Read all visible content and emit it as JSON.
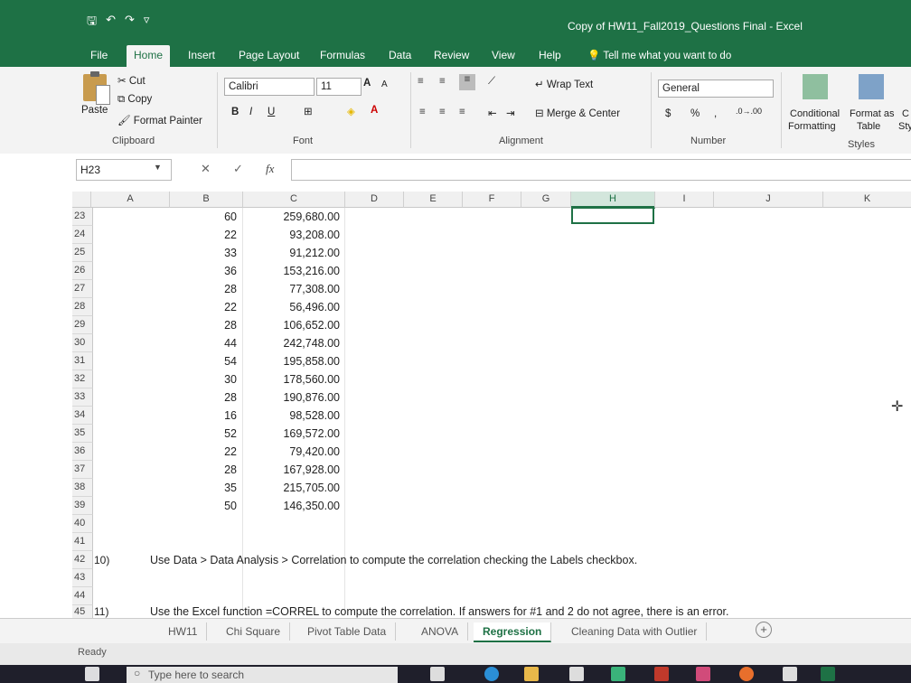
{
  "window": {
    "title": "Copy of HW11_Fall2019_Questions Final  -  Excel"
  },
  "qat": {
    "save": "🖫",
    "undo": "↶",
    "redo": "↷",
    "customize": "▿"
  },
  "tabs": [
    "File",
    "Home",
    "Insert",
    "Page Layout",
    "Formulas",
    "Data",
    "Review",
    "View",
    "Help"
  ],
  "tell_me": "Tell me what you want to do",
  "clipboard": {
    "paste": "Paste",
    "cut": "Cut",
    "copy": "Copy",
    "format_painter": "Format Painter",
    "label": "Clipboard"
  },
  "font": {
    "name": "Calibri",
    "size": "11",
    "bold": "B",
    "italic": "I",
    "underline": "U",
    "grow": "A",
    "shrink": "A",
    "label": "Font"
  },
  "alignment": {
    "wrap": "Wrap Text",
    "merge": "Merge & Center",
    "label": "Alignment"
  },
  "number": {
    "format": "General",
    "currency": "$",
    "percent": "%",
    "comma": ",",
    "label": "Number"
  },
  "styles": {
    "conditional": "Conditional",
    "conditional2": "Formatting",
    "table": "Format as",
    "table2": "Table",
    "cell": "C",
    "cell2": "Sty",
    "label": "Styles"
  },
  "formula_bar": {
    "name_box": "H23",
    "fx": "fx",
    "content": ""
  },
  "columns": [
    "A",
    "B",
    "C",
    "D",
    "E",
    "F",
    "G",
    "H",
    "I",
    "J",
    "K"
  ],
  "rows": [
    {
      "num": "23",
      "b": "60",
      "c": "259,680.00"
    },
    {
      "num": "24",
      "b": "22",
      "c": "93,208.00"
    },
    {
      "num": "25",
      "b": "33",
      "c": "91,212.00"
    },
    {
      "num": "26",
      "b": "36",
      "c": "153,216.00"
    },
    {
      "num": "27",
      "b": "28",
      "c": "77,308.00"
    },
    {
      "num": "28",
      "b": "22",
      "c": "56,496.00"
    },
    {
      "num": "29",
      "b": "28",
      "c": "106,652.00"
    },
    {
      "num": "30",
      "b": "44",
      "c": "242,748.00"
    },
    {
      "num": "31",
      "b": "54",
      "c": "195,858.00"
    },
    {
      "num": "32",
      "b": "30",
      "c": "178,560.00"
    },
    {
      "num": "33",
      "b": "28",
      "c": "190,876.00"
    },
    {
      "num": "34",
      "b": "16",
      "c": "98,528.00"
    },
    {
      "num": "35",
      "b": "52",
      "c": "169,572.00"
    },
    {
      "num": "36",
      "b": "22",
      "c": "79,420.00"
    },
    {
      "num": "37",
      "b": "28",
      "c": "167,928.00"
    },
    {
      "num": "38",
      "b": "35",
      "c": "215,705.00"
    },
    {
      "num": "39",
      "b": "50",
      "c": "146,350.00"
    },
    {
      "num": "40",
      "b": "",
      "c": ""
    },
    {
      "num": "41",
      "b": "",
      "c": ""
    },
    {
      "num": "42",
      "a": "10)",
      "note": "Use Data > Data Analysis > Correlation to compute the correlation checking the Labels checkbox."
    },
    {
      "num": "43",
      "b": "",
      "c": ""
    },
    {
      "num": "44",
      "b": "",
      "c": ""
    },
    {
      "num": "45",
      "a": "11)",
      "note": "Use the Excel function =CORREL to compute the correlation. If answers for #1 and 2 do not agree, there is an error."
    }
  ],
  "sheets": [
    "HW11",
    "Chi Square",
    "Pivot Table Data",
    "ANOVA",
    "Regression",
    "Cleaning Data with Outlier"
  ],
  "active_sheet": "Regression",
  "status": "Ready",
  "taskbar": {
    "search_placeholder": "Type here to search"
  },
  "colors": {
    "excel_green": "#1e7145"
  }
}
